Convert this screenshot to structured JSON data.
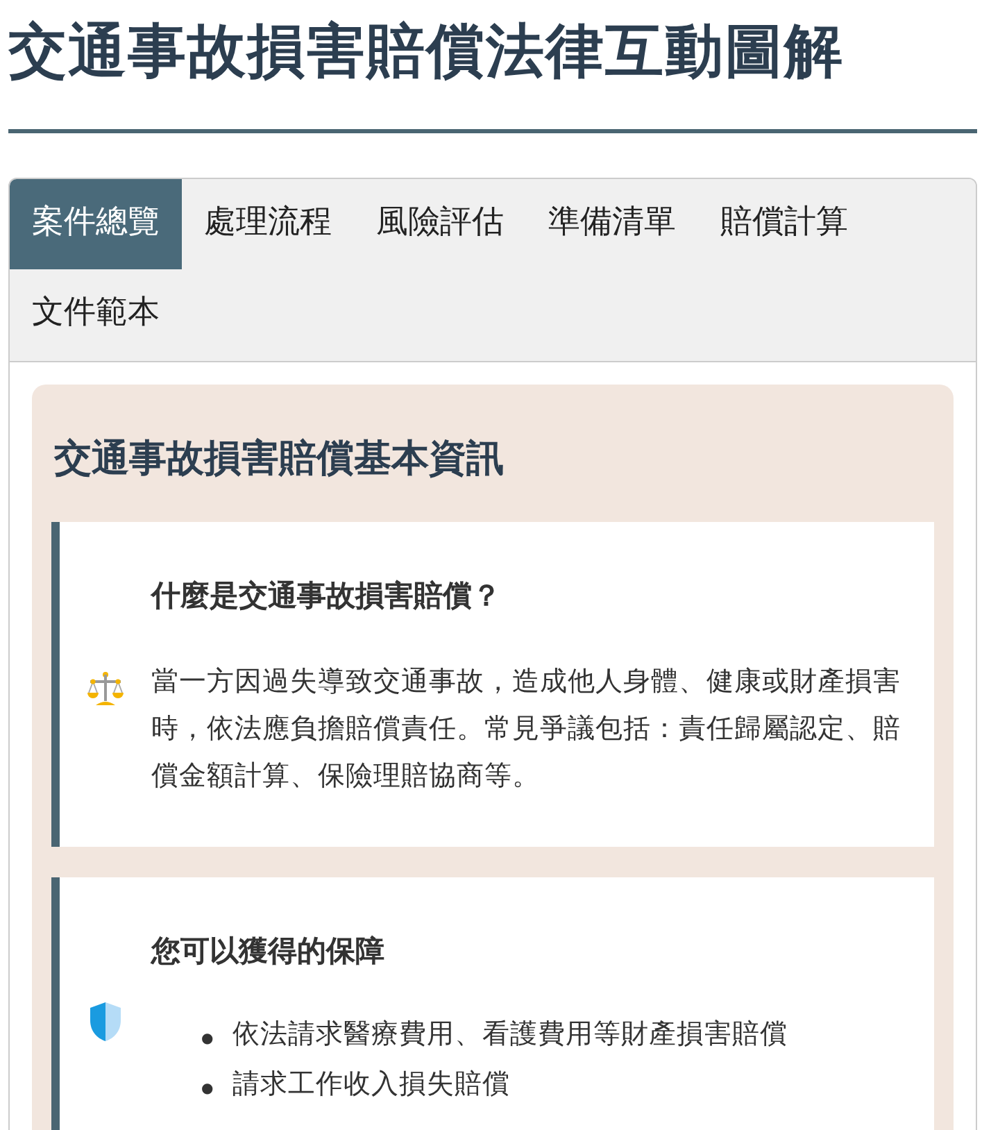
{
  "title": "交通事故損害賠償法律互動圖解",
  "tabs": [
    {
      "label": "案件總覽",
      "selected": true
    },
    {
      "label": "處理流程",
      "selected": false
    },
    {
      "label": "風險評估",
      "selected": false
    },
    {
      "label": "準備清單",
      "selected": false
    },
    {
      "label": "賠償計算",
      "selected": false
    },
    {
      "label": "文件範本",
      "selected": false
    }
  ],
  "panel": {
    "heading": "交通事故損害賠償基本資訊",
    "sections": [
      {
        "kind": "paragraph",
        "heading": "什麼是交通事故損害賠償？",
        "text": "當一方因過失導致交通事故，造成他人身體、健康或財產損害時，依法應負擔賠償責任。常見爭議包括：責任歸屬認定、賠償金額計算、保險理賠協商等。"
      },
      {
        "kind": "list",
        "heading": "您可以獲得的保障",
        "bullet": "●",
        "items": [
          "依法請求醫療費用、看護費用等財產損害賠償",
          "請求工作收入損失賠償"
        ]
      }
    ]
  }
}
